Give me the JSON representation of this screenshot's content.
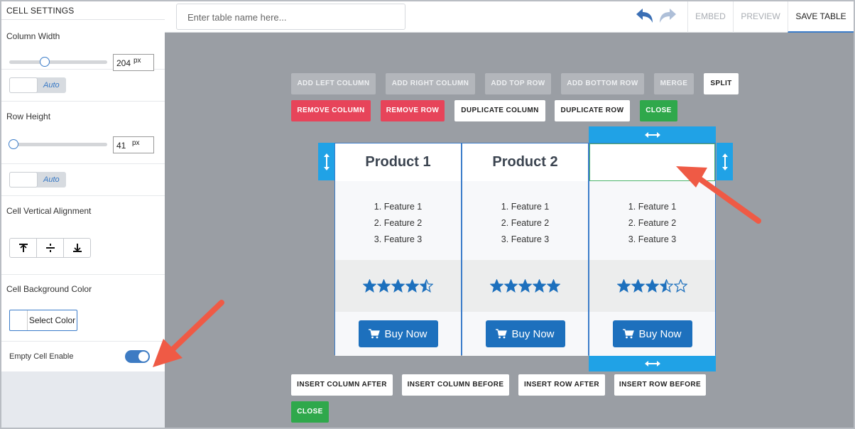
{
  "sidebar": {
    "title": "CELL SETTINGS",
    "column_width": {
      "label": "Column Width",
      "value": "204",
      "unit": "px",
      "slider_fraction": 0.36
    },
    "row_height": {
      "label": "Row Height",
      "value": "41",
      "unit": "px",
      "slider_fraction": 0.04
    },
    "auto_label": "Auto",
    "vertical_alignment": {
      "label": "Cell Vertical Alignment"
    },
    "background_color": {
      "label": "Cell Background Color",
      "button": "Select Color"
    },
    "empty_cell": {
      "label": "Empty Cell Enable",
      "enabled": true
    }
  },
  "topbar": {
    "table_name_placeholder": "Enter table name here...",
    "tabs": {
      "embed": "EMBED",
      "preview": "PREVIEW",
      "save": "SAVE TABLE"
    }
  },
  "actions": {
    "add_left_column": "ADD LEFT COLUMN",
    "add_right_column": "ADD RIGHT COLUMN",
    "add_top_row": "ADD TOP ROW",
    "add_bottom_row": "ADD BOTTOM ROW",
    "merge": "MERGE",
    "split": "SPLIT",
    "remove_column": "REMOVE COLUMN",
    "remove_row": "REMOVE ROW",
    "duplicate_column": "DUPLICATE COLUMN",
    "duplicate_row": "DUPLICATE ROW",
    "close": "CLOSE"
  },
  "bottom_actions": {
    "insert_column_after": "INSERT COLUMN AFTER",
    "insert_column_before": "INSERT COLUMN BEFORE",
    "insert_row_after": "INSERT ROW AFTER",
    "insert_row_before": "INSERT ROW BEFORE",
    "close": "CLOSE"
  },
  "table": {
    "columns": [
      {
        "title": "Product 1",
        "features": [
          "1. Feature 1",
          "2. Feature 2",
          "3. Feature 3"
        ],
        "rating": 4.5,
        "button": "Buy Now"
      },
      {
        "title": "Product 2",
        "features": [
          "1. Feature 1",
          "2. Feature 2",
          "3. Feature 3"
        ],
        "rating": 5,
        "button": "Buy Now"
      },
      {
        "title": "",
        "features": [
          "1. Feature 1",
          "2. Feature 2",
          "3. Feature 3"
        ],
        "rating": 3.5,
        "button": "Buy Now"
      }
    ]
  },
  "colors": {
    "accent": "#3b7cc9",
    "handle": "#20a2e6",
    "remove": "#e7445a",
    "close": "#2fa84b",
    "annotation_arrow": "#ef5a45",
    "star": "#1d70bd"
  }
}
